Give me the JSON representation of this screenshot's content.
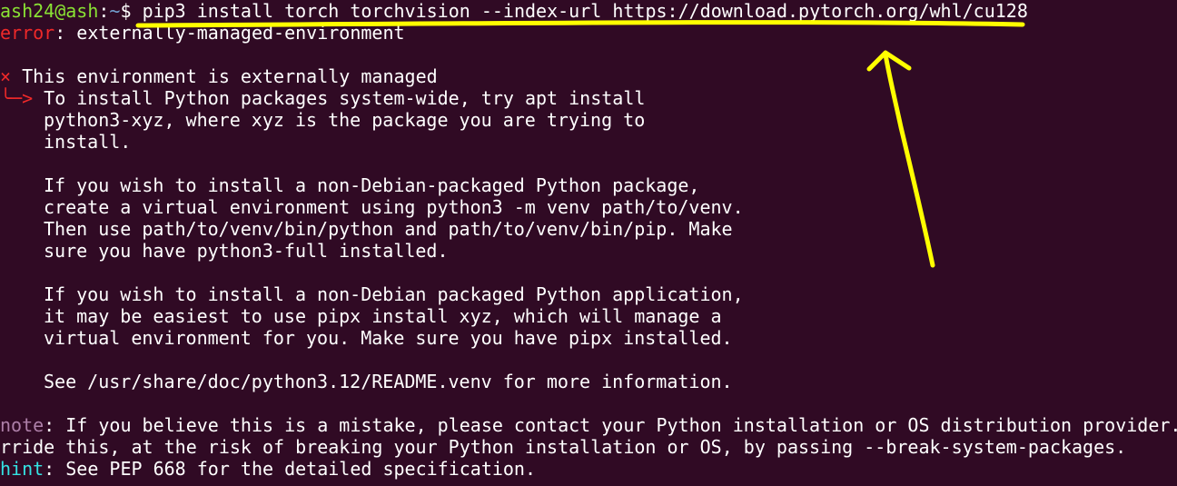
{
  "prompt": {
    "user_host": "ash24@ash",
    "colon": ":",
    "cwd": "~",
    "symbol": "$ ",
    "command": "pip3 install torch torchvision --index-url https://download.pytorch.org/whl/cu128"
  },
  "error": {
    "tag": "error",
    "message": ": externally-managed-environment"
  },
  "managed": {
    "bullet": "×",
    "text": " This environment is externally managed",
    "arrow": "╰─>"
  },
  "body_lines": [
    " To install Python packages system-wide, try apt install",
    "python3-xyz, where xyz is the package you are trying to",
    "install.",
    "",
    "If you wish to install a non-Debian-packaged Python package,",
    "create a virtual environment using python3 -m venv path/to/venv.",
    "Then use path/to/venv/bin/python and path/to/venv/bin/pip. Make",
    "sure you have python3-full installed.",
    "",
    "If you wish to install a non-Debian packaged Python application,",
    "it may be easiest to use pipx install xyz, which will manage a",
    "virtual environment for you. Make sure you have pipx installed.",
    "",
    "See /usr/share/doc/python3.12/README.venv for more information."
  ],
  "note": {
    "tag": "note",
    "message": ": If you believe this is a mistake, please contact your Python installation or OS distribution provider.",
    "continuation": "rride this, at the risk of breaking your Python installation or OS, by passing --break-system-packages."
  },
  "hint": {
    "tag": "hint",
    "message": ": See PEP 668 for the detailed specification."
  },
  "colors": {
    "background": "#300a24",
    "annotation": "#ffff00"
  }
}
